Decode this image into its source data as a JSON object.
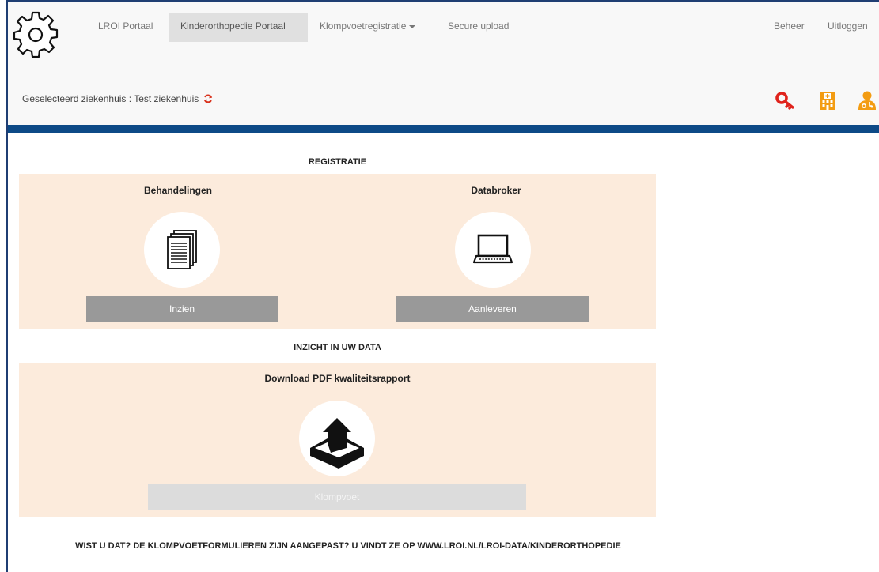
{
  "nav": {
    "items": [
      {
        "label": "LROI Portaal"
      },
      {
        "label": "Kinderorthopedie Portaal"
      },
      {
        "label": "Klompvoetregistratie"
      },
      {
        "label": "Secure upload"
      }
    ],
    "right": [
      {
        "label": "Beheer"
      },
      {
        "label": "Uitloggen"
      }
    ]
  },
  "hospital": {
    "text": "Geselecteerd ziekenhuis : Test ziekenhuis"
  },
  "header_icons": [
    {
      "name": "key-icon",
      "color": "#e0231c"
    },
    {
      "name": "hospital-building-icon",
      "color": "#f39c12"
    },
    {
      "name": "doctor-user-icon",
      "color": "#f39c12"
    }
  ],
  "registratie": {
    "title": "REGISTRATIE",
    "cards": [
      {
        "title": "Behandelingen",
        "icon": "documents-icon",
        "button": "Inzien"
      },
      {
        "title": "Databroker",
        "icon": "laptop-icon",
        "button": "Aanleveren"
      }
    ]
  },
  "inzicht": {
    "title": "INZICHT IN UW DATA",
    "card": {
      "title": "Download PDF kwaliteitsrapport",
      "icon": "upload-tray-icon",
      "button": "Klompvoet"
    }
  },
  "footer": {
    "text": "WIST U DAT? DE KLOMPVOETFORMULIEREN ZIJN AANGEPAST? U VINDT ZE OP WWW.LROI.NL/LROI-DATA/KINDERORTHOPEDIE"
  },
  "colors": {
    "nav_active": "#e0e0e0",
    "blue_bar": "#0d4a87",
    "panel": "#fcebdc",
    "button": "#999999"
  }
}
